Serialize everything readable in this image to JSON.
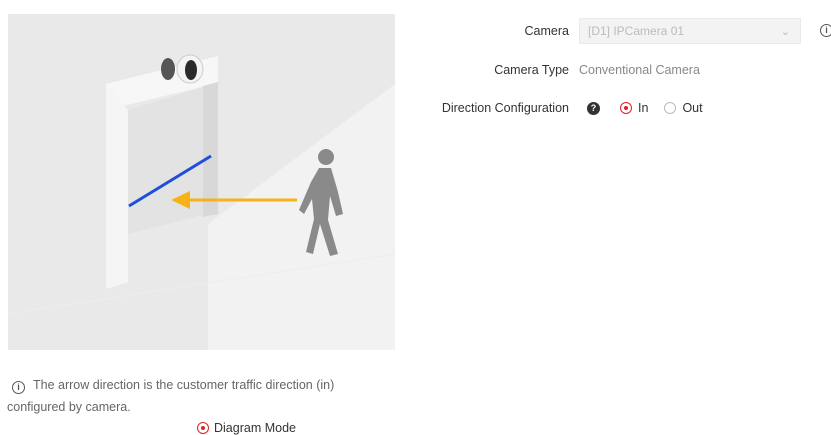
{
  "illustration": {
    "colors": {
      "background": "#e7e7e7",
      "line": "#1e4fd8",
      "arrow": "#f5b318",
      "figure": "#8a8a8a"
    }
  },
  "tip": {
    "icon": "info-icon",
    "line1": "The arrow direction is the customer traffic direction (in)",
    "line2": "configured by camera."
  },
  "mode": {
    "label": "Diagram Mode",
    "selected": true
  },
  "form": {
    "camera": {
      "label": "Camera",
      "value": "[D1] IPCamera 01",
      "icon": "chevron-down-icon",
      "disabled": true
    },
    "camera_type": {
      "label": "Camera Type",
      "value": "Conventional Camera"
    },
    "direction": {
      "label": "Direction Configuration",
      "help_icon": "question-icon",
      "options": [
        {
          "label": "In",
          "selected": true
        },
        {
          "label": "Out",
          "selected": false
        }
      ]
    }
  },
  "accent_color": "#e0202a"
}
